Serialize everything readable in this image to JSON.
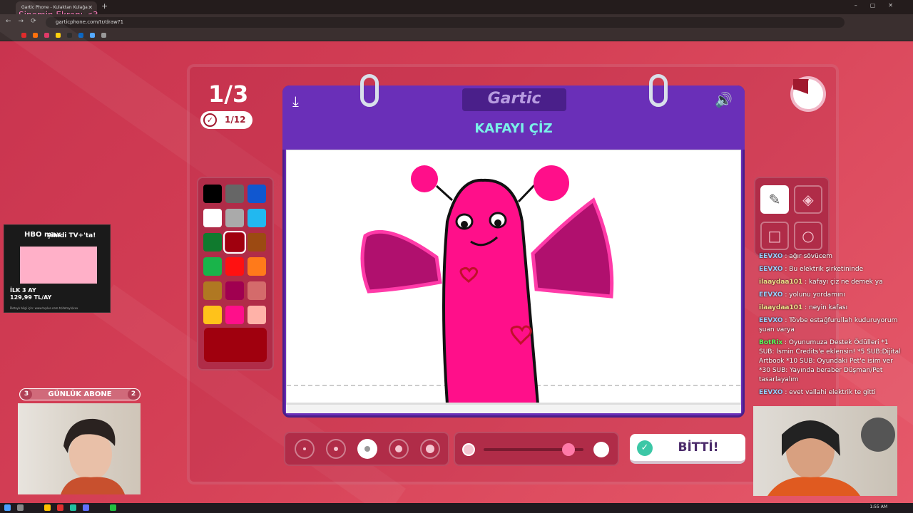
{
  "browser": {
    "tab_title": "Gartic Phone - Kulaktan Kulağa",
    "overlay_title": "Sinemin Ekranı <3",
    "url": "garticphone.com/tr/draw?1"
  },
  "game": {
    "round": "1/3",
    "counter": "1/12",
    "logo": "Gartic",
    "prompt": "KAFAYI ÇİZ",
    "done_label": "BİTTİ!",
    "selected_color": "#a0000e",
    "palette": [
      "#000000",
      "#666666",
      "#1057d0",
      "#ffffff",
      "#aaaaaa",
      "#21b8f0",
      "#107a2e",
      "#a0000e",
      "#9c4a12",
      "#19b44a",
      "#ff1111",
      "#ff7a1a",
      "#b07822",
      "#a00050",
      "#d46b6b",
      "#ffc21a",
      "#ff0f8a",
      "#ffb2a8"
    ],
    "brush_sizes": [
      1,
      2,
      3,
      4,
      5
    ],
    "selected_size": 3,
    "opacity": 0.85
  },
  "ad": {
    "brand": "HBO max",
    "headline": "şimdi TV+'ta!",
    "price": "İLK 3 AY\n129,99 TL/AY",
    "fine": "Detaylı bilgi için: www.tvplus.com.tr/detaylı/xxx"
  },
  "stream": {
    "sub_label": "GÜNLÜK ABONE",
    "sub_left": "3",
    "sub_right": "2",
    "chat": [
      {
        "user": "EEVXO",
        "text": ": ağır sövücem",
        "color": "#9ad0ff"
      },
      {
        "user": "EEVXO",
        "text": ": Bu elektrik şirketininde",
        "color": "#9ad0ff"
      },
      {
        "user": "ilaaydaa101",
        "text": ": kafayı çiz ne demek ya",
        "color": "#f0e08a"
      },
      {
        "user": "EEVXO",
        "text": ": yolunu yordamını",
        "color": "#9ad0ff"
      },
      {
        "user": "ilaaydaa101",
        "text": ": neyin kafası",
        "color": "#f0e08a"
      },
      {
        "user": "EEVXO",
        "text": ": Tövbe estağfurullah kuduruyorum şuan varya",
        "color": "#9ad0ff"
      },
      {
        "user": "BotRix",
        "text": ": Oyunumuza Destek Ödülleri *1 SUB: İsmin Credits'e eklensin! *5 SUB:Dijital Artbook *10 SUB: Oyundaki Pet'e isim ver *30 SUB: Yayında beraber Düşman/Pet tasarlayalım",
        "color": "#5cff5c"
      },
      {
        "user": "EEVXO",
        "text": ": evet vallahi elektrik te gitti",
        "color": "#9ad0ff"
      }
    ]
  },
  "taskbar": {
    "time": "1:55 AM"
  }
}
